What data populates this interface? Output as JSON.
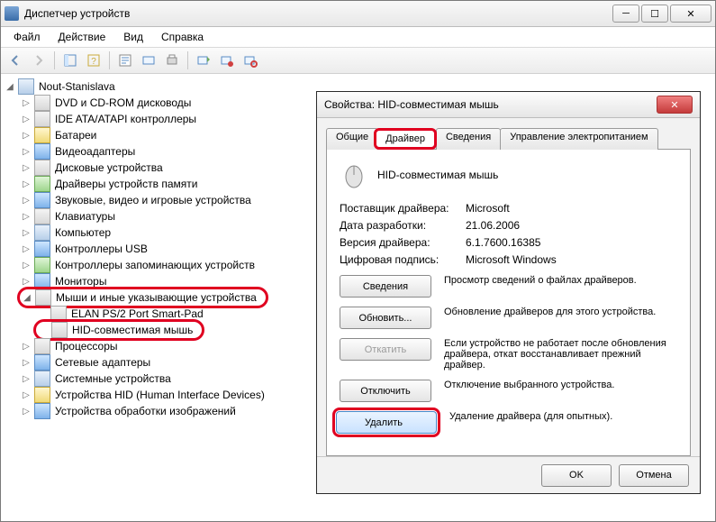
{
  "window": {
    "title": "Диспетчер устройств",
    "min_glyph": "─",
    "max_glyph": "☐",
    "close_glyph": "✕"
  },
  "menu": {
    "file": "Файл",
    "action": "Действие",
    "view": "Вид",
    "help": "Справка"
  },
  "tree": {
    "root": "Nout-Stanislava",
    "items": [
      "DVD и CD-ROM дисководы",
      "IDE ATA/ATAPI контроллеры",
      "Батареи",
      "Видеоадаптеры",
      "Дисковые устройства",
      "Драйверы устройств памяти",
      "Звуковые, видео и игровые устройства",
      "Клавиатуры",
      "Компьютер",
      "Контроллеры USB",
      "Контроллеры запоминающих устройств",
      "Мониторы",
      "Мыши и иные указывающие устройства",
      "Процессоры",
      "Сетевые адаптеры",
      "Системные устройства",
      "Устройства HID (Human Interface Devices)",
      "Устройства обработки изображений"
    ],
    "mouse_children": [
      "ELAN PS/2 Port Smart-Pad",
      "HID-совместимая мышь"
    ]
  },
  "dialog": {
    "title": "Свойства: HID-совместимая мышь",
    "close_glyph": "✕",
    "tabs": {
      "general": "Общие",
      "driver": "Драйвер",
      "details": "Сведения",
      "power": "Управление электропитанием"
    },
    "device_name": "HID-совместимая мышь",
    "fields": {
      "provider_k": "Поставщик драйвера:",
      "provider_v": "Microsoft",
      "date_k": "Дата разработки:",
      "date_v": "21.06.2006",
      "version_k": "Версия драйвера:",
      "version_v": "6.1.7600.16385",
      "sign_k": "Цифровая подпись:",
      "sign_v": "Microsoft Windows"
    },
    "buttons": {
      "details": "Сведения",
      "details_desc": "Просмотр сведений о файлах драйверов.",
      "update": "Обновить...",
      "update_desc": "Обновление драйверов для этого устройства.",
      "rollback": "Откатить",
      "rollback_desc": "Если устройство не работает после обновления драйвера, откат восстанавливает прежний драйвер.",
      "disable": "Отключить",
      "disable_desc": "Отключение выбранного устройства.",
      "remove": "Удалить",
      "remove_desc": "Удаление драйвера (для опытных)."
    },
    "ok": "OK",
    "cancel": "Отмена"
  }
}
